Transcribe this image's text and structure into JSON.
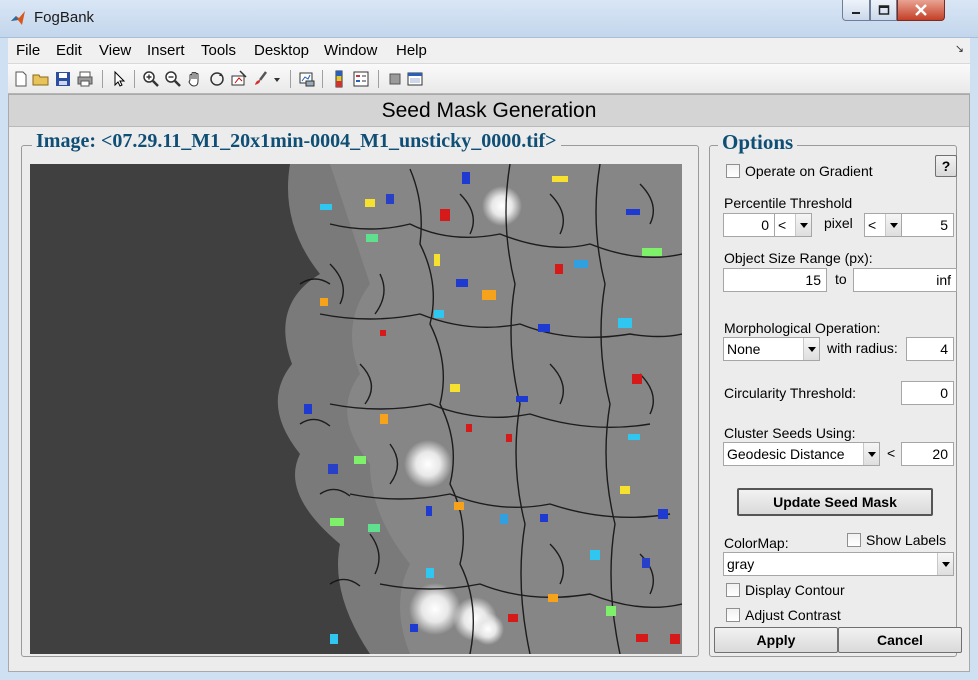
{
  "window": {
    "title": "FogBank"
  },
  "menu": [
    "File",
    "Edit",
    "View",
    "Insert",
    "Tools",
    "Desktop",
    "Window",
    "Help"
  ],
  "header": {
    "title": "Seed Mask Generation"
  },
  "image_panel": {
    "title": "Image: <07.29.11_M1_20x1min-0004_M1_unsticky_0000.tif>"
  },
  "options": {
    "title": "Options",
    "help_label": "?",
    "operate_on_gradient": {
      "label": "Operate on Gradient",
      "checked": false
    },
    "percentile_threshold": {
      "label": "Percentile Threshold",
      "low_value": "0",
      "low_op": "<",
      "middle_label": "pixel",
      "high_op": "<",
      "high_value": "5"
    },
    "object_size_range": {
      "label": "Object Size Range (px):",
      "min": "15",
      "to_label": "to",
      "max": "inf"
    },
    "morphological": {
      "label": "Morphological Operation:",
      "operation": "None",
      "radius_label": "with radius:",
      "radius": "4"
    },
    "circularity": {
      "label": "Circularity Threshold:",
      "value": "0"
    },
    "cluster": {
      "label": "Cluster Seeds Using:",
      "method": "Geodesic Distance",
      "op": "<",
      "value": "20"
    },
    "update_button": "Update Seed Mask",
    "colormap": {
      "label": "ColorMap:",
      "value": "gray"
    },
    "show_labels": {
      "label": "Show Labels",
      "checked": false
    },
    "display_contour": {
      "label": "Display Contour",
      "checked": false
    },
    "adjust_contrast": {
      "label": "Adjust Contrast",
      "checked": false
    },
    "apply_button": "Apply",
    "cancel_button": "Cancel"
  }
}
